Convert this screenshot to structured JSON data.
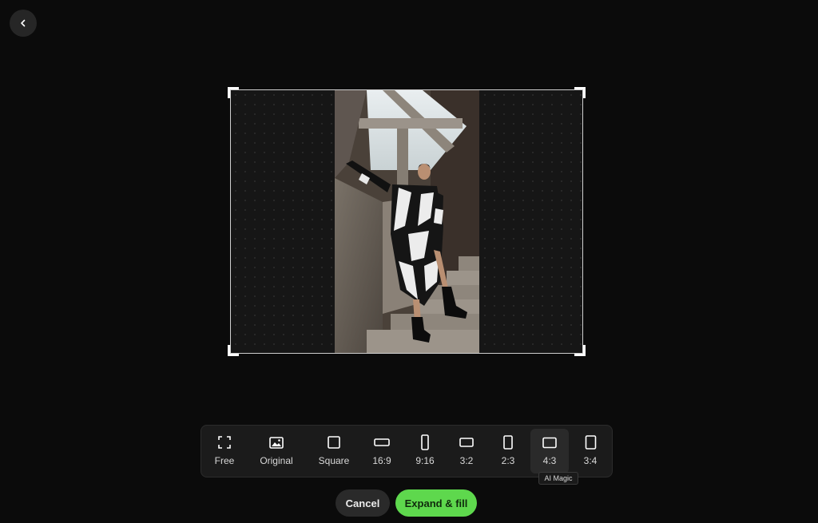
{
  "back": {
    "icon": "chevron-left-icon"
  },
  "canvas": {
    "photo_description": "fashion-model-on-concrete-stairs-image"
  },
  "ratios": [
    {
      "label": "Free",
      "icon": "free-crop-icon"
    },
    {
      "label": "Original",
      "icon": "image-icon"
    },
    {
      "label": "Square",
      "icon": "square-icon"
    },
    {
      "label": "16:9",
      "icon": "ratio-16-9-icon"
    },
    {
      "label": "9:16",
      "icon": "ratio-9-16-icon"
    },
    {
      "label": "3:2",
      "icon": "ratio-3-2-icon"
    },
    {
      "label": "2:3",
      "icon": "ratio-2-3-icon"
    },
    {
      "label": "4:3",
      "icon": "ratio-4-3-icon",
      "active": true
    },
    {
      "label": "3:4",
      "icon": "ratio-3-4-icon"
    }
  ],
  "tooltip": "AI Magic",
  "actions": {
    "cancel": "Cancel",
    "expand": "Expand & fill"
  },
  "colors": {
    "background": "#0b0b0b",
    "accent": "#5ed84d",
    "toolbar": "#1b1b1b"
  }
}
